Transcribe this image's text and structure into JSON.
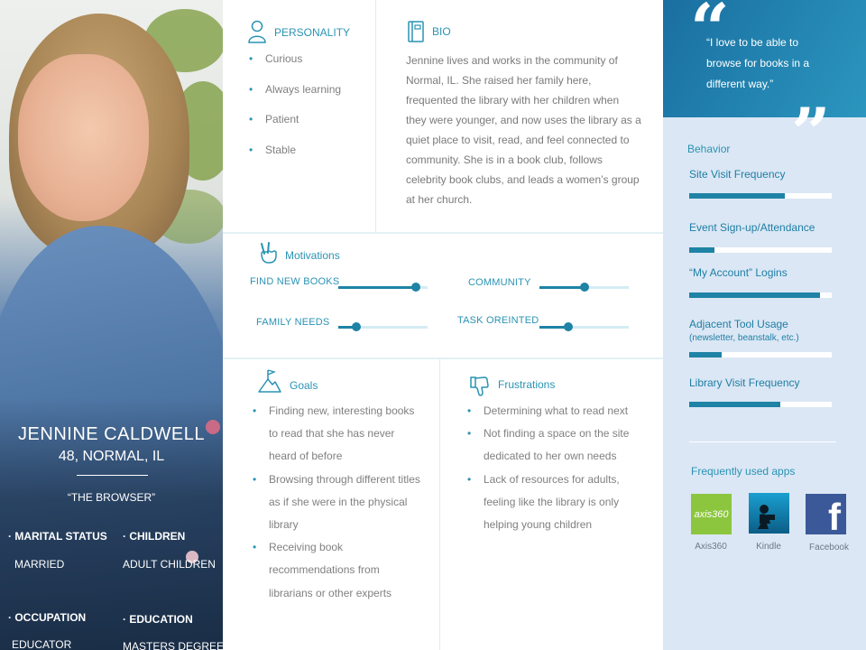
{
  "persona": {
    "name": "JENNINE CALDWELL",
    "location": "48, NORMAL, IL",
    "tagline": "“THE BROWSER”",
    "facts": [
      {
        "label": "· MARITAL STATUS",
        "value": "MARRIED"
      },
      {
        "label": "· CHILDREN",
        "value": "ADULT CHILDREN"
      },
      {
        "label": "· OCCUPATION",
        "value": "EDUCATOR"
      },
      {
        "label": "· EDUCATION",
        "value": "MASTERS DEGREE"
      }
    ]
  },
  "personality": {
    "title": "PERSONALITY",
    "items": [
      "Curious",
      "Always learning",
      "Patient",
      "Stable"
    ]
  },
  "bio": {
    "title": "BIO",
    "text": "Jennine lives and works in the community of Normal, IL. She raised her family here, frequented the library with her children when they were younger, and now uses the library as a quiet place to visit, read, and feel connected to community. She is in a book club, follows celebrity book clubs, and leads a women’s group at her church."
  },
  "motivations": {
    "title": "Motivations",
    "items": [
      {
        "label": "FIND NEW BOOKS",
        "level": 0.87
      },
      {
        "label": "COMMUNITY",
        "level": 0.5
      },
      {
        "label": "FAMILY NEEDS",
        "level": 0.2
      },
      {
        "label": "TASK OREINTED",
        "level": 0.32
      }
    ]
  },
  "goals": {
    "title": "Goals",
    "items": [
      "Finding new, interesting books to read that she has never heard of before",
      "Browsing through different titles as if she were in the physical library",
      "Receiving book recommendations from librarians or other experts"
    ]
  },
  "frustrations": {
    "title": "Frustrations",
    "items": [
      "Determining what to read next",
      "Not finding a space on the site dedicated to her own needs",
      "Lack of resources for adults, feeling like the library is only helping young children"
    ]
  },
  "quote": {
    "open_mark": "“",
    "close_mark": "”",
    "text": "“I love to be able to browse for books in a different way.”"
  },
  "behavior": {
    "title": "Behavior",
    "items": [
      {
        "label": "Site Visit Frequency",
        "sublabel": "",
        "level": 0.67
      },
      {
        "label": "Event Sign-up/Attendance",
        "sublabel": "",
        "level": 0.18
      },
      {
        "label": "“My Account” Logins",
        "sublabel": "",
        "level": 0.92
      },
      {
        "label": "Adjacent Tool Usage",
        "sublabel": "(newsletter, beanstalk, etc.)",
        "level": 0.23
      },
      {
        "label": "Library Visit Frequency",
        "sublabel": "",
        "level": 0.64
      }
    ]
  },
  "apps": {
    "title": "Frequently used apps",
    "items": [
      {
        "name": "Axis360",
        "logo_text": "axis360",
        "color": "#8cc63f"
      },
      {
        "name": "Kindle",
        "logo_text": "",
        "color": "#0f7ea7"
      },
      {
        "name": "Facebook",
        "logo_text": "f",
        "color": "#3b5998"
      }
    ]
  },
  "colors": {
    "accent": "#2a93b3",
    "bar": "#1e83a5",
    "panel": "#dbe7f5"
  }
}
